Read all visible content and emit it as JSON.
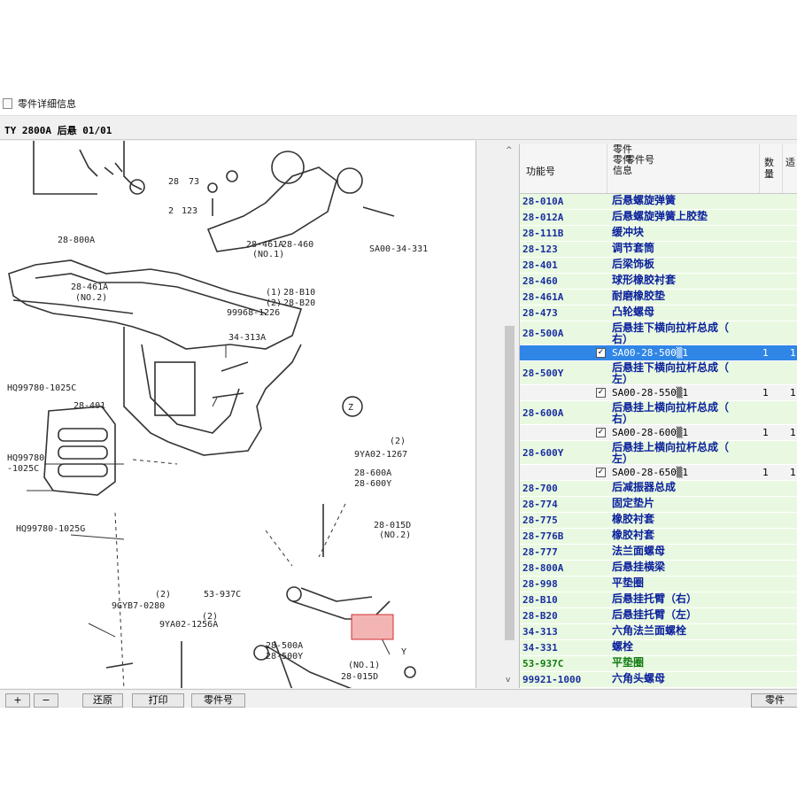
{
  "window": {
    "title": "零件详细信息"
  },
  "info": {
    "text": "TY  2800A 后悬 01/01"
  },
  "diagram": {
    "labels": [
      "28",
      "73",
      "2",
      "123",
      "28-461A",
      "(NO.2)",
      "28-800A",
      "28-461A",
      "(NO.1)",
      "28-460",
      "(1)",
      "28-B10",
      "(2)",
      "28-B20",
      "99968-1226",
      "34-313A",
      "SA00-34-331",
      "Z",
      "HQ99780-1025C",
      "28-401",
      "HQ99780",
      "-1025C",
      "HQ99780-1025G",
      "9YA02-1267",
      "(2)",
      "28-600A",
      "28-600Y",
      "28-015D",
      "(NO.2)",
      "Z",
      "(2)",
      "9GYB7-0280",
      "53-937C",
      "(2)",
      "9YA02-1256A",
      "28-500A",
      "28-500Y",
      "(NO.1)",
      "28-015D",
      "Y"
    ]
  },
  "parts_table": {
    "headers": {
      "code": "功能号",
      "name_a": "零件",
      "name_b": "零件号",
      "name_c": "信息",
      "qty": "数量",
      "extra": "适"
    },
    "rows": [
      {
        "type": "part",
        "code": "28-010A",
        "name": "后悬螺旋弹簧"
      },
      {
        "type": "part",
        "code": "28-012A",
        "name": "后悬螺旋弹簧上胶垫"
      },
      {
        "type": "part",
        "code": "28-111B",
        "name": "缓冲块"
      },
      {
        "type": "part",
        "code": "28-123",
        "name": "调节套筒"
      },
      {
        "type": "part",
        "code": "28-401",
        "name": "后梁饰板"
      },
      {
        "type": "part",
        "code": "28-460",
        "name": "球形橡胶衬套"
      },
      {
        "type": "part",
        "code": "28-461A",
        "name": "耐磨橡胶垫"
      },
      {
        "type": "part",
        "code": "28-473",
        "name": "凸轮螺母"
      },
      {
        "type": "part2",
        "code": "28-500A",
        "name": "后悬挂下横向拉杆总成（",
        "name2": "右）"
      },
      {
        "type": "sub",
        "selected": true,
        "check": "✓",
        "name": "SA00-28-500▒1",
        "qty": "1",
        "more": "1"
      },
      {
        "type": "part2",
        "code": "28-500Y",
        "name": "后悬挂下横向拉杆总成（",
        "name2": "左）"
      },
      {
        "type": "sub",
        "selected": false,
        "check": "✓",
        "name": "SA00-28-550▒1",
        "qty": "1",
        "more": "1"
      },
      {
        "type": "part2",
        "code": "28-600A",
        "name": "后悬挂上横向拉杆总成（",
        "name2": "右）"
      },
      {
        "type": "sub",
        "selected": false,
        "check": "✓",
        "name": "SA00-28-600▒1",
        "qty": "1",
        "more": "1"
      },
      {
        "type": "part2",
        "code": "28-600Y",
        "name": "后悬挂上横向拉杆总成（",
        "name2": "左）"
      },
      {
        "type": "sub",
        "selected": false,
        "check": "✓",
        "name": "SA00-28-650▒1",
        "qty": "1",
        "more": "1"
      },
      {
        "type": "part",
        "code": "28-700",
        "name": "后减振器总成"
      },
      {
        "type": "part",
        "code": "28-774",
        "name": "固定垫片"
      },
      {
        "type": "part",
        "code": "28-775",
        "name": "橡胶衬套"
      },
      {
        "type": "part",
        "code": "28-776B",
        "name": "橡胶衬套"
      },
      {
        "type": "part",
        "code": "28-777",
        "name": "法兰面螺母"
      },
      {
        "type": "part",
        "code": "28-800A",
        "name": "后悬挂横梁"
      },
      {
        "type": "part",
        "code": "28-998",
        "name": "平垫圈"
      },
      {
        "type": "part",
        "code": "28-B10",
        "name": "后悬挂托臂（右）"
      },
      {
        "type": "part",
        "code": "28-B20",
        "name": "后悬挂托臂（左）"
      },
      {
        "type": "part",
        "code": "34-313",
        "name": "六角法兰面螺栓"
      },
      {
        "type": "part",
        "code": "34-331",
        "name": "螺栓"
      },
      {
        "type": "part",
        "green": true,
        "code": "53-937C",
        "name": "平垫圈"
      },
      {
        "type": "part",
        "code": "99921-1000",
        "name": "六角头螺母"
      }
    ]
  },
  "toolbar": {
    "zoom_in": "+",
    "zoom_out": "−",
    "restore": "还原",
    "print": "打印",
    "part_no": "零件号",
    "part_right": "零件"
  },
  "scroll": {
    "up": "^",
    "down": "v"
  },
  "colors": {
    "selected_row": "#2f86e6",
    "row_bg": "#e9f9e1",
    "code_text": "#1a2ea0",
    "name_text": "#0a1f9c",
    "highlight_label": "#e07070"
  }
}
